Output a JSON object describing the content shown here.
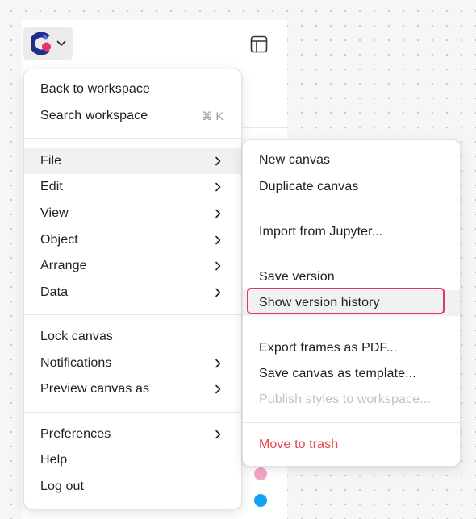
{
  "main_menu": {
    "back_to_workspace": "Back to workspace",
    "search_workspace": "Search workspace",
    "search_shortcut": "⌘ K",
    "file": "File",
    "edit": "Edit",
    "view": "View",
    "object": "Object",
    "arrange": "Arrange",
    "data": "Data",
    "lock_canvas": "Lock canvas",
    "notifications": "Notifications",
    "preview_canvas_as": "Preview canvas as",
    "preferences": "Preferences",
    "help": "Help",
    "log_out": "Log out"
  },
  "file_submenu": {
    "new_canvas": "New canvas",
    "duplicate_canvas": "Duplicate canvas",
    "import_from_jupyter": "Import from Jupyter...",
    "save_version": "Save version",
    "show_version_history": "Show version history",
    "export_frames_as_pdf": "Export frames as PDF...",
    "save_canvas_as_template": "Save canvas as template...",
    "publish_styles_to_workspace": "Publish styles to workspace...",
    "move_to_trash": "Move to trash"
  },
  "icons": {
    "app_logo": "app-logo-icon",
    "layout_toggle": "panel-layout-icon",
    "submenu_arrow": "chevron-right-icon",
    "logo_dropdown": "chevron-down-icon"
  },
  "colors": {
    "danger_text": "#e5484d",
    "highlight_outline": "#e0327a",
    "logo_blue": "#1f2d8c",
    "logo_pink": "#e8336e",
    "avatar_pink": "#f3a6c8",
    "avatar_blue": "#12a4f0"
  }
}
